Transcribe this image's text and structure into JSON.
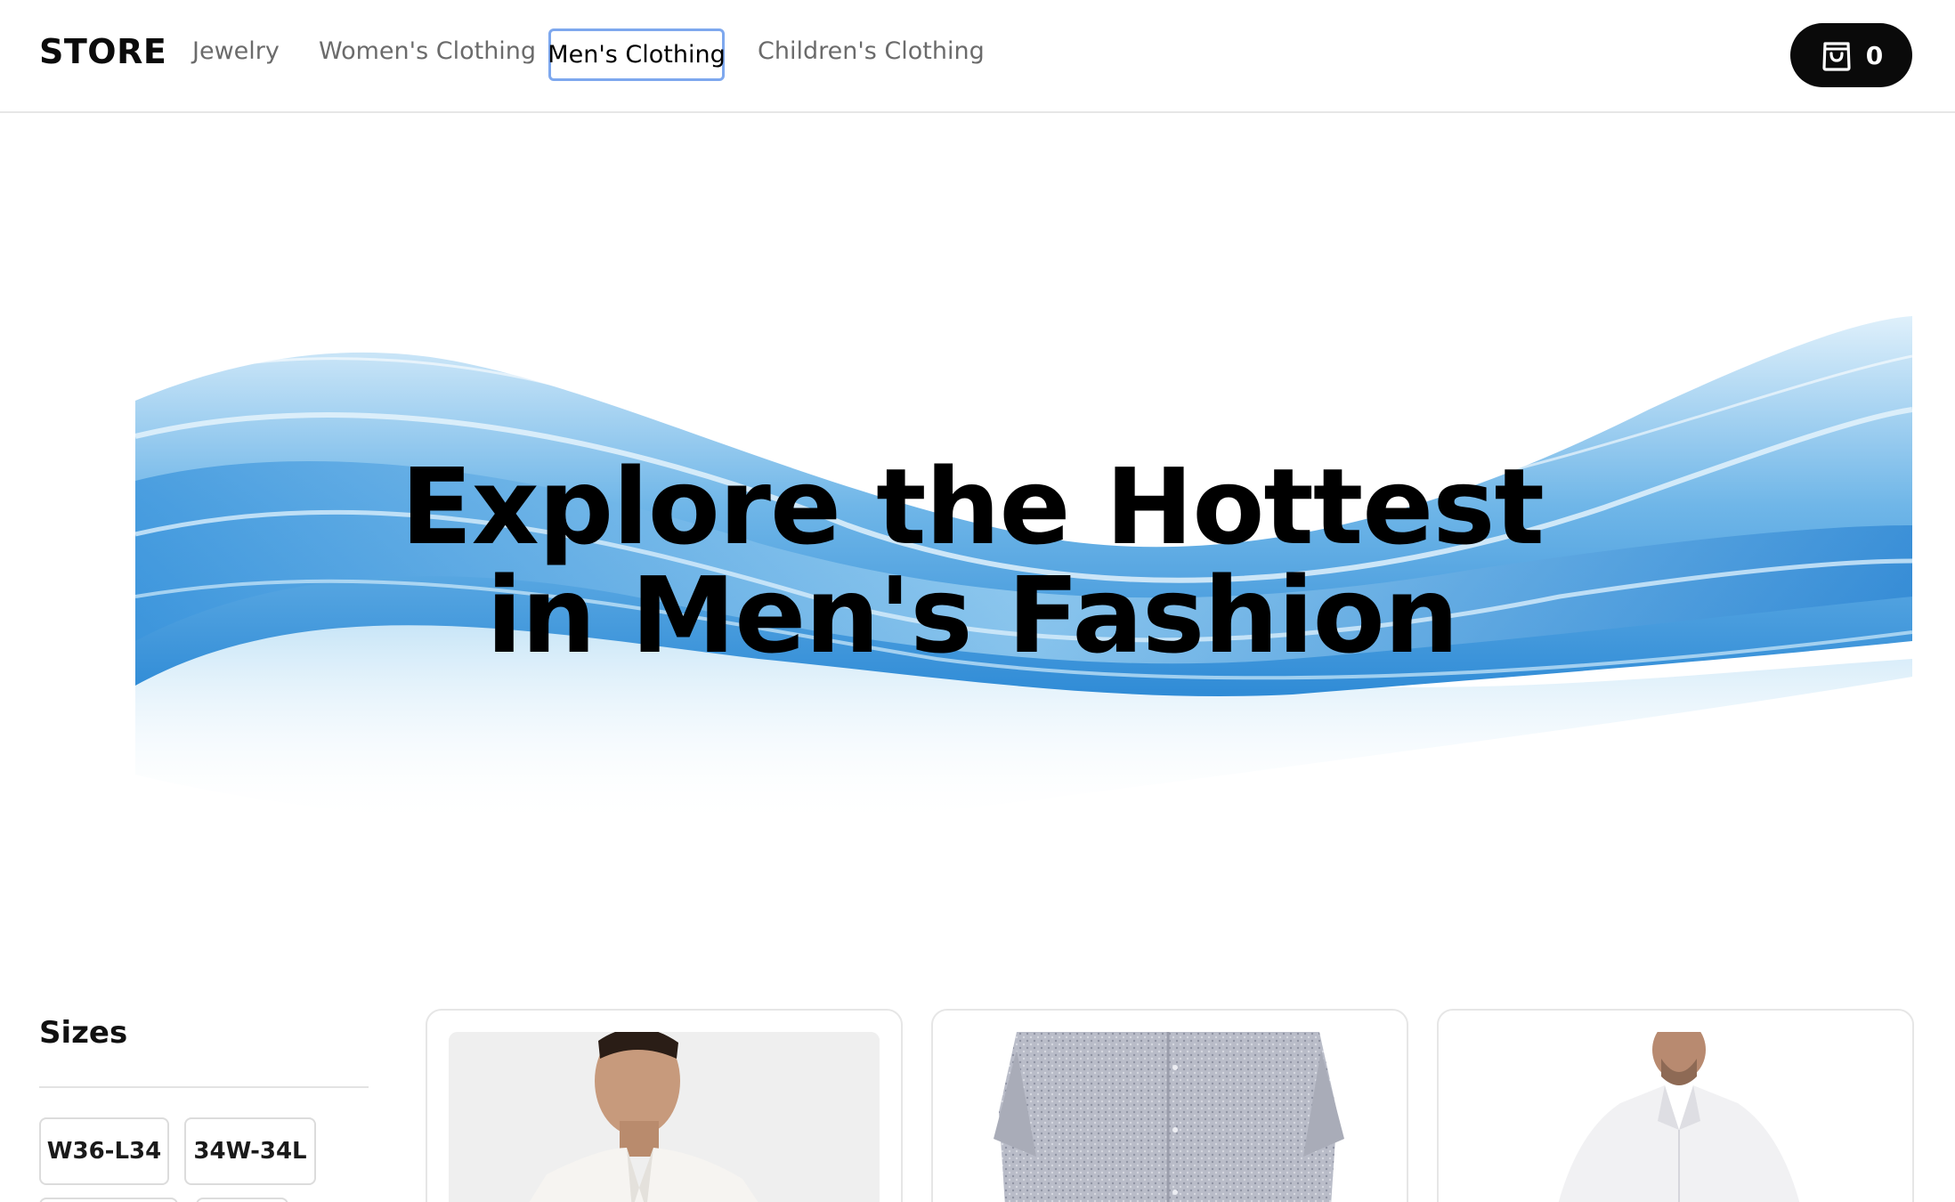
{
  "header": {
    "brand": "STORE",
    "nav": [
      {
        "label": "Jewelry"
      },
      {
        "label": "Women's Clothing"
      },
      {
        "label": "Men's Clothing",
        "active": true
      },
      {
        "label": "Children's Clothing"
      }
    ],
    "cart": {
      "icon": "shopping-bag-icon",
      "count": "0"
    }
  },
  "hero": {
    "line1": "Explore the Hottest",
    "line2": "in Men's Fashion"
  },
  "filters": {
    "heading": "Sizes",
    "sizes": [
      "W36-L34",
      "34W-34L"
    ]
  },
  "products": [
    {
      "image": "model-white-shirt"
    },
    {
      "image": "grey-patterned-short-sleeve-shirt"
    },
    {
      "image": "white-dress-shirt"
    }
  ],
  "colors": {
    "accent": "#0a0a0a",
    "active_outline": "#7ea8ee",
    "wave_blue": "#3f97dd",
    "wave_light": "#a8d6f2"
  }
}
